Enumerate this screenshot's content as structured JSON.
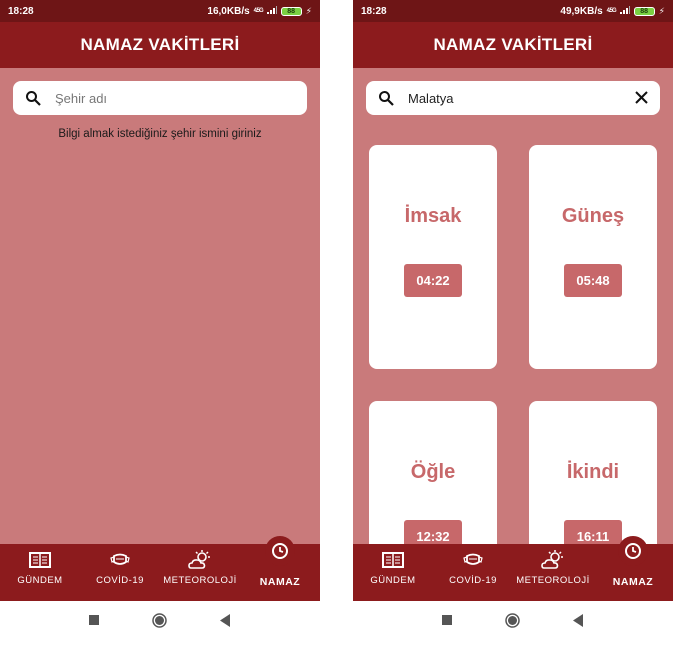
{
  "colors": {
    "status_bar": "#6e1516",
    "app_bar": "#8c1b1d",
    "content_bg": "#c97a7b",
    "accent": "#c7686a"
  },
  "left": {
    "status": {
      "time": "18:28",
      "speed": "16,0KB/s",
      "network": "4.5G",
      "battery": "88"
    },
    "app_title": "NAMAZ VAKİTLERİ",
    "search": {
      "placeholder": "Şehir adı",
      "value": ""
    },
    "hint": "Bilgi almak istediğiniz şehir ismini giriniz"
  },
  "right": {
    "status": {
      "time": "18:28",
      "speed": "49,9KB/s",
      "network": "4.5G",
      "battery": "88"
    },
    "app_title": "NAMAZ VAKİTLERİ",
    "search": {
      "placeholder": "Şehir adı",
      "value": "Malatya"
    },
    "prayer_times": [
      {
        "name": "İmsak",
        "time": "04:22"
      },
      {
        "name": "Güneş",
        "time": "05:48"
      },
      {
        "name": "Öğle",
        "time": "12:32"
      },
      {
        "name": "İkindi",
        "time": "16:11"
      }
    ]
  },
  "nav": [
    {
      "label": "GÜNDEM",
      "icon": "newspaper-icon"
    },
    {
      "label": "COVİD-19",
      "icon": "mask-icon"
    },
    {
      "label": "METEOROLOJİ",
      "icon": "weather-icon"
    },
    {
      "label": "NAMAZ",
      "icon": "clock-icon",
      "active": true
    }
  ],
  "system_nav": [
    "recents-icon",
    "home-icon",
    "back-icon"
  ]
}
